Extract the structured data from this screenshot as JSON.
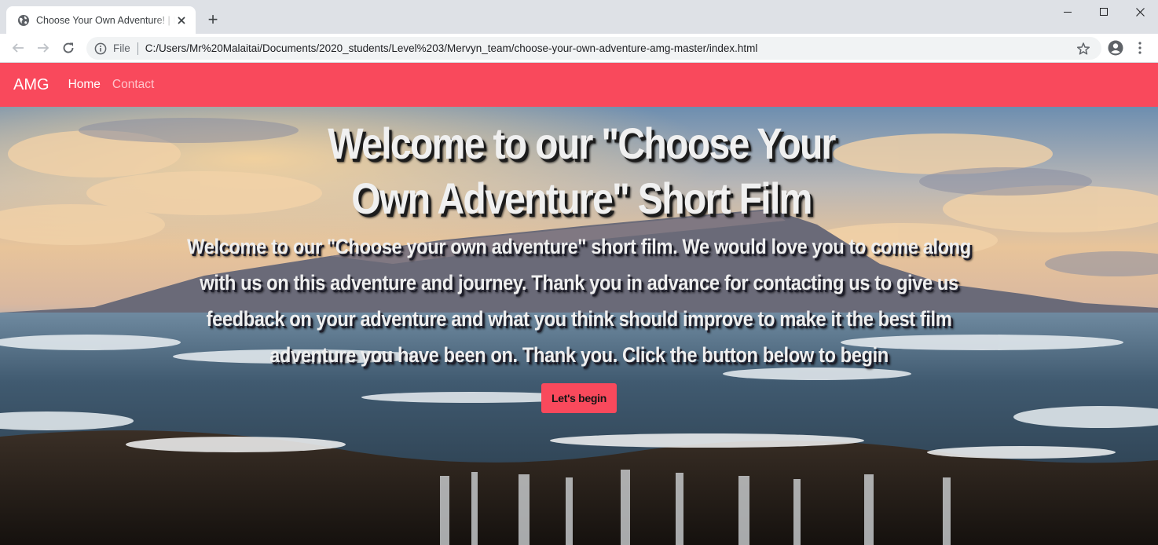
{
  "browser": {
    "tab_title": "Choose Your Own Adventure! | Home",
    "new_tab_label": "+",
    "omnibox": {
      "security_label": "File",
      "url": "C:/Users/Mr%20Malaitai/Documents/2020_students/Level%203/Mervyn_team/choose-your-own-adventure-amg-master/index.html"
    },
    "icons": {
      "favicon": "globe-icon",
      "back": "back-arrow-icon",
      "forward": "forward-arrow-icon",
      "reload": "reload-icon",
      "info": "info-icon",
      "star": "star-icon",
      "profile": "account-icon",
      "menu": "kebab-menu-icon"
    }
  },
  "navbar": {
    "brand": "AMG",
    "links": [
      {
        "label": "Home",
        "active": true
      },
      {
        "label": "Contact",
        "active": false
      }
    ],
    "color": "#f9495c"
  },
  "hero": {
    "title": "Welcome to our \"Choose Your Own Adventure\" Short Film",
    "text": "Welcome to our \"Choose your own adventure\" short film. We would love you to come along with us on this adventure and journey. Thank you in advance for contacting us to give us feedback on your adventure and what you think should improve to make it the best film adventure you have been on. Thank you. Click the button below to begin",
    "button_label": "Let's begin"
  }
}
